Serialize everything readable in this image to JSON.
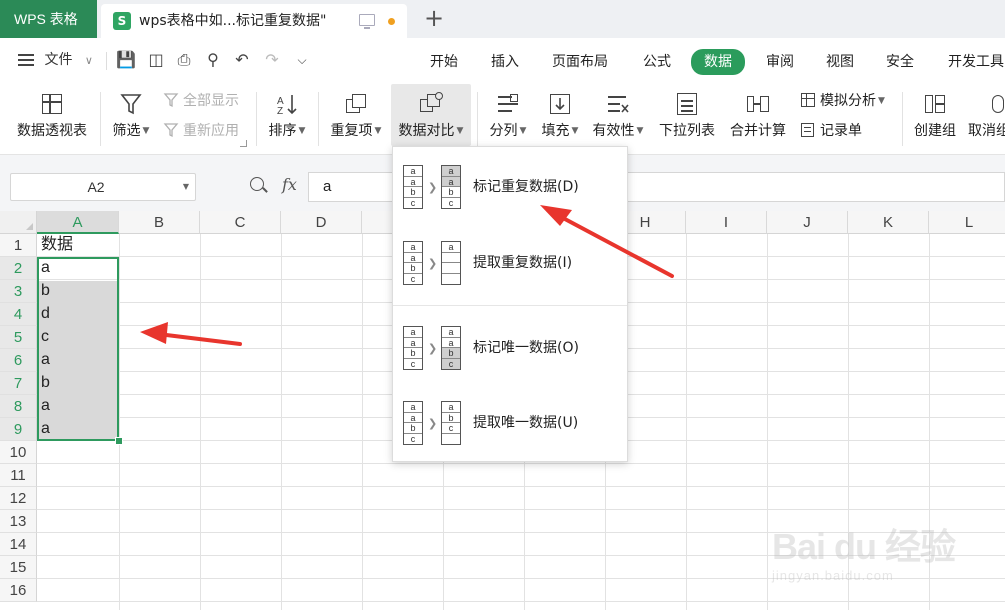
{
  "tabs": {
    "app": "WPS 表格",
    "doc_logo": "S",
    "doc_title": "wps表格中如...标记重复数据\"",
    "new_tab": "+"
  },
  "menu": {
    "file": "文件",
    "items": [
      "开始",
      "插入",
      "页面布局",
      "公式",
      "数据",
      "审阅",
      "视图",
      "安全",
      "开发工具"
    ],
    "active": "数据"
  },
  "ribbon": {
    "pivot": "数据透视表",
    "filter": "筛选",
    "show_all": "全部显示",
    "reapply": "重新应用",
    "sort": "排序",
    "duplicates": "重复项",
    "compare": "数据对比",
    "split": "分列",
    "fill": "填充",
    "validity": "有效性",
    "dropdown_list": "下拉列表",
    "consolidate": "合并计算",
    "simulation": "模拟分析",
    "record_form": "记录单",
    "create_group": "创建组",
    "ungroup": "取消组"
  },
  "formula_bar": {
    "cell_ref": "A2",
    "fx": "fx",
    "value": "a"
  },
  "sheet": {
    "columns": [
      "A",
      "B",
      "C",
      "D",
      "E",
      "F",
      "G",
      "H",
      "I",
      "J",
      "K",
      "L"
    ],
    "rows": [
      "1",
      "2",
      "3",
      "4",
      "5",
      "6",
      "7",
      "8",
      "9",
      "10",
      "11",
      "12",
      "13",
      "14",
      "15",
      "16"
    ],
    "colA": [
      "数据",
      "a",
      "b",
      "d",
      "c",
      "a",
      "b",
      "a",
      "a"
    ]
  },
  "dropdown": {
    "items": [
      {
        "label": "标记重复数据(D)",
        "left": [
          "a",
          "a",
          "b",
          "c"
        ],
        "right": [
          "a",
          "a",
          "b",
          "c"
        ]
      },
      {
        "label": "提取重复数据(I)",
        "left": [
          "a",
          "a",
          "b",
          "c"
        ],
        "right": [
          "a",
          "",
          "",
          ""
        ]
      },
      {
        "label": "标记唯一数据(O)",
        "left": [
          "a",
          "a",
          "b",
          "c"
        ],
        "right": [
          "a",
          "a",
          "b",
          "c"
        ]
      },
      {
        "label": "提取唯一数据(U)",
        "left": [
          "a",
          "a",
          "b",
          "c"
        ],
        "right": [
          "a",
          "b",
          "c",
          ""
        ]
      }
    ]
  },
  "watermark": {
    "text": "Bai du 经验",
    "url": "jingyan.baidu.com"
  },
  "colors": {
    "accent": "#2b9c5c",
    "app_tab": "#2b8a57",
    "arrow": "#e8352d",
    "selection_fill": "#d9d9d9"
  }
}
